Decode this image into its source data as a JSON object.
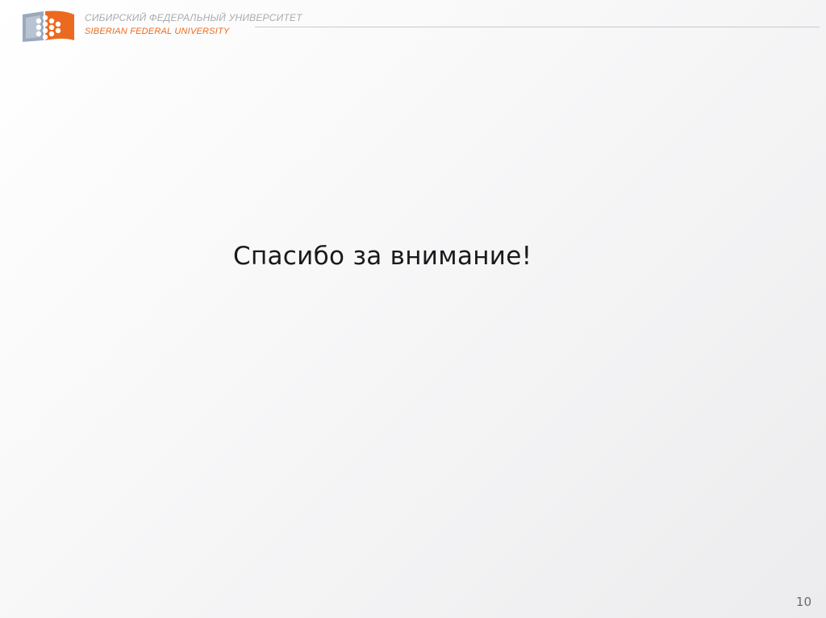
{
  "header": {
    "university_ru": "СИБИРСКИЙ ФЕДЕРАЛЬНЫЙ УНИВЕРСИТЕТ",
    "university_en": "SIBERIAN FEDERAL UNIVERSITY",
    "logo_icon": "sfu-logo-icon",
    "colors": {
      "orange": "#ec6a1f",
      "grey": "#a9abb0",
      "blue_grey": "#8d9db2"
    }
  },
  "slide": {
    "message": "Спасибо за внимание!",
    "page_number": "10"
  }
}
